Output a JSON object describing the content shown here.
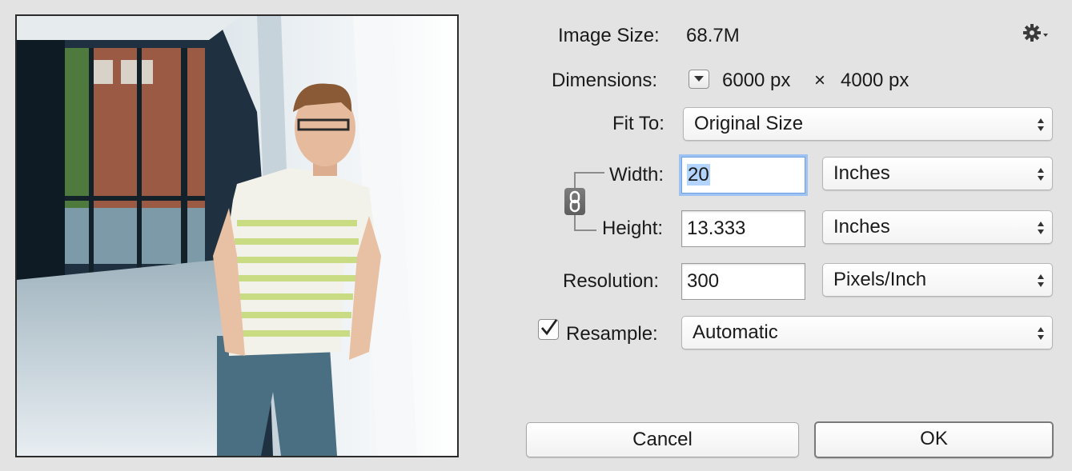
{
  "dialog": {
    "image_size": {
      "label": "Image Size:",
      "value": "68.7M"
    },
    "dimensions": {
      "label": "Dimensions:",
      "width": "6000 px",
      "times": "×",
      "height": "4000 px"
    },
    "fit_to": {
      "label": "Fit To:",
      "value": "Original Size"
    },
    "width": {
      "label": "Width:",
      "value": "20",
      "unit": "Inches"
    },
    "height": {
      "label": "Height:",
      "value": "13.333",
      "unit": "Inches"
    },
    "resolution": {
      "label": "Resolution:",
      "value": "300",
      "unit": "Pixels/Inch"
    },
    "resample": {
      "label": "Resample:",
      "checked": true,
      "value": "Automatic"
    },
    "buttons": {
      "cancel": "Cancel",
      "ok": "OK"
    },
    "icons": {
      "settings": "gear-icon",
      "dimensions_menu": "dropdown-arrow-icon",
      "constrain": "chain-link-icon",
      "checkbox": "checkmark-icon",
      "select": "up-down-arrows-icon"
    },
    "colors": {
      "focus_ring": "#9ec2f1",
      "selection": "#b3d4fc",
      "background": "#e3e3e3"
    }
  }
}
